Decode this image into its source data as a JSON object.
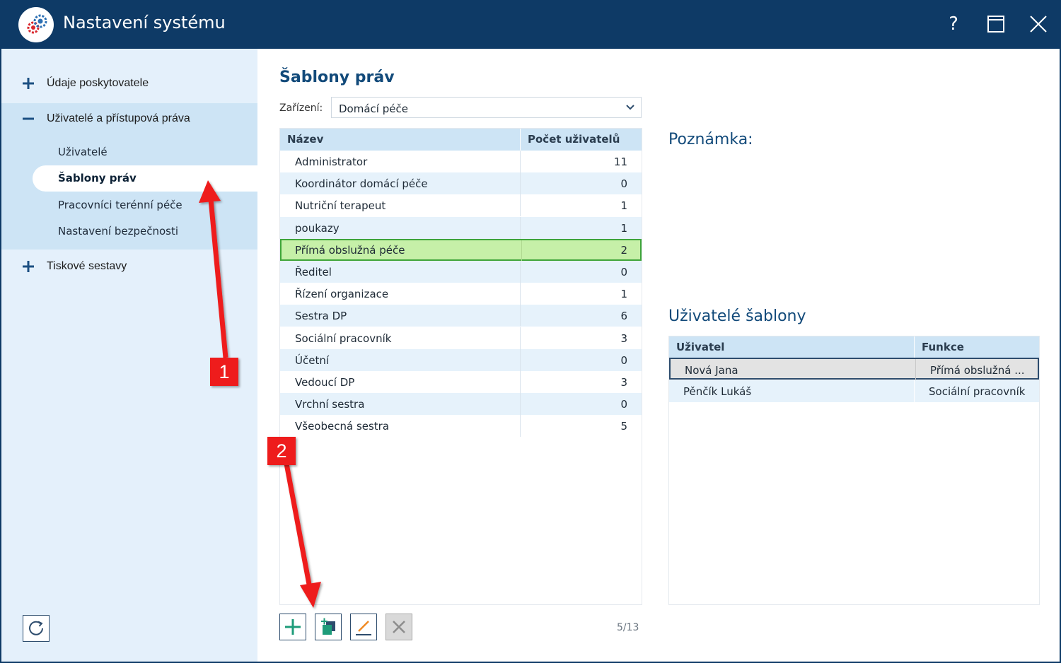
{
  "window": {
    "title": "Nastavení systému",
    "help_label": "?",
    "icon": "settings-gears-icon"
  },
  "sidebar": {
    "items": [
      {
        "label": "Údaje poskytovatele",
        "sign": "plus-icon"
      },
      {
        "label": "Uživatelé a přístupová práva",
        "sign": "minus-icon",
        "children": [
          {
            "label": "Uživatelé"
          },
          {
            "label": "Šablony práv",
            "active": true
          },
          {
            "label": "Pracovníci terénní péče"
          },
          {
            "label": "Nastavení bezpečnosti"
          }
        ]
      },
      {
        "label": "Tiskové sestavy",
        "sign": "plus-icon"
      }
    ],
    "refresh_icon": "refresh-icon"
  },
  "main": {
    "title": "Šablony práv",
    "device_label": "Zařízení:",
    "device_value": "Domácí péče",
    "table": {
      "headers": [
        "Název",
        "Počet uživatelů"
      ],
      "rows": [
        {
          "name": "Administrator",
          "count": "11"
        },
        {
          "name": "Koordinátor domácí péče",
          "count": "0"
        },
        {
          "name": "Nutriční terapeut",
          "count": "1"
        },
        {
          "name": "poukazy",
          "count": "1"
        },
        {
          "name": "Přímá obslužná péče",
          "count": "2",
          "selected": true
        },
        {
          "name": "Ředitel",
          "count": "0"
        },
        {
          "name": "Řízení organizace",
          "count": "1"
        },
        {
          "name": "Sestra DP",
          "count": "6"
        },
        {
          "name": "Sociální pracovník",
          "count": "3"
        },
        {
          "name": "Účetní",
          "count": "0"
        },
        {
          "name": "Vedoucí DP",
          "count": "3"
        },
        {
          "name": "Vrchní sestra",
          "count": "0"
        },
        {
          "name": "Všeobecná sestra",
          "count": "5"
        }
      ]
    },
    "toolbar": {
      "add_icon": "plus-icon",
      "copy_icon": "copy-add-icon",
      "edit_icon": "pencil-icon",
      "delete_icon": "close-icon"
    },
    "counter": "5/13",
    "note_title": "Poznámka:",
    "users_title": "Uživatelé šablony",
    "users_table": {
      "headers": [
        "Uživatel",
        "Funkce"
      ],
      "rows": [
        {
          "name": "Nová Jana",
          "function": "Přímá obslužná ...",
          "selected": true
        },
        {
          "name": "Pěnčík Lukáš",
          "function": "Sociální pracovník"
        }
      ]
    }
  },
  "annotations": [
    {
      "label": "1",
      "color": "#ee1c1c"
    },
    {
      "label": "2",
      "color": "#ee1c1c"
    }
  ],
  "colors": {
    "titlebar": "#0e3a66",
    "sidebar": "#e4f0fb",
    "selected_row": "#c6f0a8",
    "accent": "#124a7a"
  }
}
